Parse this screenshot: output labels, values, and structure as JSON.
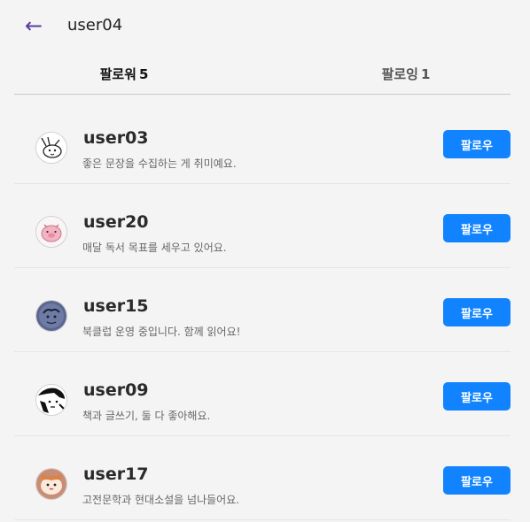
{
  "header": {
    "back_icon": "arrow-left-icon",
    "title": "user04"
  },
  "tabs": [
    {
      "label": "팔로워",
      "count": "5",
      "active": true
    },
    {
      "label": "팔로잉",
      "count": "1",
      "active": false
    }
  ],
  "colors": {
    "accent": "#1183ff",
    "back_arrow": "#5b3a9e",
    "background": "#f4f4f4"
  },
  "users": [
    {
      "username": "user03",
      "bio": "좋은 문장을 수집하는 게 취미예요.",
      "button": "팔로우",
      "avatar": "rabbit-sketch-avatar"
    },
    {
      "username": "user20",
      "bio": "매달 독서 목표를 세우고 있어요.",
      "button": "팔로우",
      "avatar": "pink-pig-avatar"
    },
    {
      "username": "user15",
      "bio": "북클럽 운영 중입니다. 함께 읽어요!",
      "button": "팔로우",
      "avatar": "dark-blue-sketch-avatar"
    },
    {
      "username": "user09",
      "bio": "책과 글쓰기, 둘 다 좋아해요.",
      "button": "팔로우",
      "avatar": "black-white-manga-avatar"
    },
    {
      "username": "user17",
      "bio": "고전문학과 현대소설을 넘나들어요.",
      "button": "팔로우",
      "avatar": "hamster-avatar"
    }
  ]
}
